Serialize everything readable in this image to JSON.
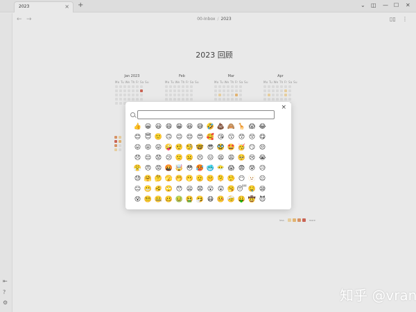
{
  "tab": {
    "title": "2023",
    "close_icon": "×"
  },
  "titlebar": {
    "new_tab_icon": "+",
    "chevron": "⌄",
    "sidebar_toggle": "◫",
    "minimize": "—",
    "maximize": "☐",
    "close": "✕"
  },
  "nav": {
    "back_icon": "←",
    "forward_icon": "→",
    "breadcrumb_parent": "00-Inbox",
    "breadcrumb_sep": "/",
    "breadcrumb_current": "2023",
    "reading_icon": "▯▯",
    "more_icon": "⋮"
  },
  "ribbon": {
    "icons": [
      "⇤",
      "?",
      "⚙"
    ]
  },
  "page": {
    "title": "2023 回顾"
  },
  "calendar": {
    "weekdays": "Mo Tu We Th Fr Sa Su",
    "months": [
      {
        "name": "Jan 2023",
        "levels": [
          0,
          0,
          0,
          0,
          0,
          0,
          0,
          0,
          0,
          0,
          0,
          0,
          0,
          4,
          0,
          0,
          0,
          0,
          0,
          0,
          0,
          0,
          0,
          0,
          0,
          0,
          0,
          0,
          0,
          0,
          0,
          0,
          0,
          0,
          0
        ]
      },
      {
        "name": "Feb",
        "levels": [
          0,
          0,
          0,
          0,
          0,
          0,
          0,
          0,
          0,
          0,
          0,
          0,
          0,
          0,
          0,
          0,
          0,
          0,
          0,
          0,
          0,
          0,
          0,
          0,
          0,
          0,
          0,
          0,
          0,
          0,
          0,
          0,
          0,
          0,
          0
        ]
      },
      {
        "name": "Mar",
        "levels": [
          0,
          0,
          0,
          0,
          0,
          0,
          0,
          0,
          0,
          0,
          0,
          0,
          0,
          0,
          0,
          1,
          0,
          0,
          0,
          2,
          0,
          0,
          0,
          0,
          0,
          0,
          0,
          0,
          0,
          0,
          0,
          0,
          0,
          0,
          0
        ]
      },
      {
        "name": "Apr",
        "levels": [
          0,
          0,
          0,
          0,
          0,
          0,
          0,
          0,
          0,
          0,
          0,
          0,
          1,
          0,
          0,
          1,
          0,
          0,
          0,
          1,
          0,
          0,
          0,
          0,
          0,
          0,
          0,
          0,
          0,
          0,
          0,
          0,
          0,
          0,
          0
        ]
      }
    ],
    "legend": {
      "less": "less",
      "more": "more",
      "levels": [
        1,
        2,
        3,
        4
      ]
    }
  },
  "colors": {
    "level1": "#f3d9a6",
    "level2": "#eebd78",
    "level3": "#e29a6a",
    "level4": "#d46a5a"
  },
  "emoji_picker": {
    "search_placeholder": "",
    "close_icon": "×",
    "emojis": [
      "👍",
      "😀",
      "😃",
      "😄",
      "😁",
      "😆",
      "😅",
      "🤣",
      "💩",
      "🙈",
      "🦒",
      "😱",
      "😂",
      "😊",
      "😇",
      "🙂",
      "🙃",
      "😉",
      "😌",
      "😍",
      "🥰",
      "😘",
      "😗",
      "😙",
      "😚",
      "😋",
      "😛",
      "😝",
      "😜",
      "🤪",
      "🤨",
      "🧐",
      "🤓",
      "😎",
      "🥸",
      "🤩",
      "🥳",
      "😏",
      "😒",
      "😞",
      "😔",
      "😟",
      "😕",
      "🙁",
      "☹️",
      "😣",
      "😖",
      "😫",
      "😩",
      "🥺",
      "😢",
      "😭",
      "😤",
      "😠",
      "😡",
      "🤬",
      "🤯",
      "😳",
      "🥵",
      "🥶",
      "😶‍🌫️",
      "😱",
      "😨",
      "😰",
      "😥",
      "😓",
      "🤗",
      "🤔",
      "🫣",
      "🤭",
      "🫢",
      "🫡",
      "🤫",
      "🫠",
      "🤥",
      "😶",
      "🫥",
      "😐",
      "😑",
      "😬",
      "🫨",
      "🙄",
      "😯",
      "😦",
      "😧",
      "😮",
      "😲",
      "🥱",
      "😴",
      "🤤",
      "😪",
      "😵",
      "😵‍💫",
      "🤐",
      "🥴",
      "🤢",
      "🤮",
      "🤧",
      "😷",
      "🤒",
      "🤕",
      "🤑",
      "🤠",
      "😈"
    ]
  },
  "watermark": "知乎 @vran"
}
